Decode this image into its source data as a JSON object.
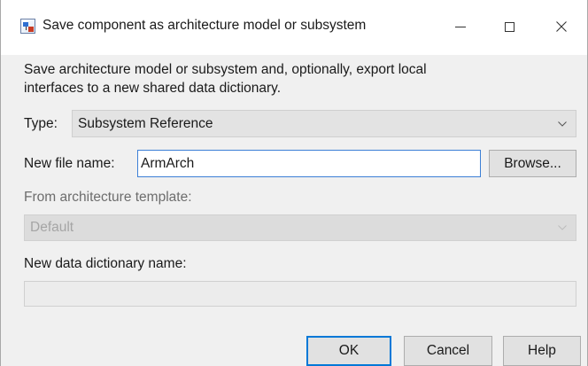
{
  "window": {
    "title": "Save component as architecture model or subsystem",
    "controls": {
      "minimize": "minimize-icon",
      "maximize": "maximize-icon",
      "close": "close-icon"
    }
  },
  "description": {
    "line1": "Save architecture model or subsystem and, optionally, export local",
    "line2": "interfaces to a new shared data dictionary."
  },
  "type": {
    "label": "Type:",
    "selected": "Subsystem Reference"
  },
  "file_name": {
    "label": "New file name:",
    "value": "ArmArch",
    "browse_label": "Browse..."
  },
  "template": {
    "label": "From architecture template:",
    "selected": "Default"
  },
  "dictionary": {
    "label": "New data dictionary name:",
    "value": ""
  },
  "buttons": {
    "ok": "OK",
    "cancel": "Cancel",
    "help": "Help"
  },
  "colors": {
    "accent": "#0078d7",
    "focus_border": "#3c7fd6",
    "dialog_bg": "#f0f0f0"
  }
}
